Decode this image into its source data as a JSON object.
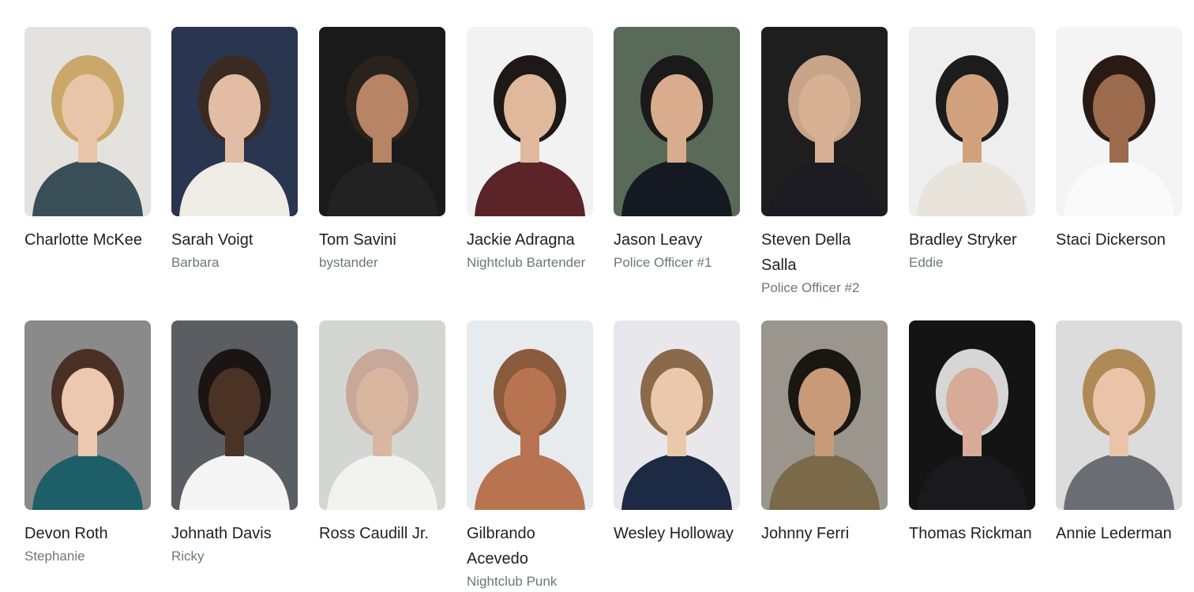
{
  "cast": [
    {
      "name": "Charlotte McKee",
      "role": "",
      "bg": "#e4e2de",
      "skin": "#e8c4a8",
      "hair": "#c9a86a",
      "shirt": "#3a4e58"
    },
    {
      "name": "Sarah Voigt",
      "role": "Barbara",
      "bg": "#2a3550",
      "skin": "#e2bca4",
      "hair": "#3a2a22",
      "shirt": "#efece6"
    },
    {
      "name": "Tom Savini",
      "role": "bystander",
      "bg": "#1a1a1a",
      "skin": "#b78466",
      "hair": "#2a221c",
      "shirt": "#222222"
    },
    {
      "name": "Jackie Adragna",
      "role": "Nightclub Bartender",
      "bg": "#f2f2f2",
      "skin": "#e0b89c",
      "hair": "#1e1816",
      "shirt": "#5a2428"
    },
    {
      "name": "Jason Leavy",
      "role": "Police Officer #1",
      "bg": "#5a6a58",
      "skin": "#d8ac8c",
      "hair": "#1a1a1a",
      "shirt": "#151a22"
    },
    {
      "name": "Steven Della Salla",
      "role": "Police Officer #2",
      "bg": "#1e1e1e",
      "skin": "#d8b094",
      "hair": "#c8a488",
      "shirt": "#1c1c22"
    },
    {
      "name": "Bradley Stryker",
      "role": "Eddie",
      "bg": "#eeeeee",
      "skin": "#d2a27e",
      "hair": "#1c1c1c",
      "shirt": "#e8e4dc"
    },
    {
      "name": "Staci Dickerson",
      "role": "",
      "bg": "#f4f4f4",
      "skin": "#9c6a4c",
      "hair": "#2a1a14",
      "shirt": "#fafafa"
    },
    {
      "name": "Devon Roth",
      "role": "Stephanie",
      "bg": "#8a8a8a",
      "skin": "#ecc8b0",
      "hair": "#4a3024",
      "shirt": "#1e5e68"
    },
    {
      "name": "Johnath Davis",
      "role": "Ricky",
      "bg": "#5a5e62",
      "skin": "#4a3224",
      "hair": "#1a1412",
      "shirt": "#f4f4f4"
    },
    {
      "name": "Ross Caudill Jr.",
      "role": "",
      "bg": "#d4d6d2",
      "skin": "#d8b6a0",
      "hair": "#c8a898",
      "shirt": "#f2f2f0"
    },
    {
      "name": "Gilbrando Acevedo",
      "role": "Nightclub Punk",
      "bg": "#e8ebee",
      "skin": "#b87450",
      "hair": "#8a5a3c",
      "shirt": "#b87450"
    },
    {
      "name": "Wesley Holloway",
      "role": "",
      "bg": "#e8e8ec",
      "skin": "#eac8ac",
      "hair": "#8a6a4a",
      "shirt": "#1c2a44"
    },
    {
      "name": "Johnny Ferri",
      "role": "",
      "bg": "#9a968e",
      "skin": "#c99a78",
      "hair": "#1a1612",
      "shirt": "#7a6a4a"
    },
    {
      "name": "Thomas Rickman",
      "role": "",
      "bg": "#141414",
      "skin": "#d8aa98",
      "hair": "#d6d6d6",
      "shirt": "#1a1a1e"
    },
    {
      "name": "Annie Lederman",
      "role": "",
      "bg": "#dcdcdc",
      "skin": "#eac4a8",
      "hair": "#b08a56",
      "shirt": "#6a6e74"
    }
  ]
}
